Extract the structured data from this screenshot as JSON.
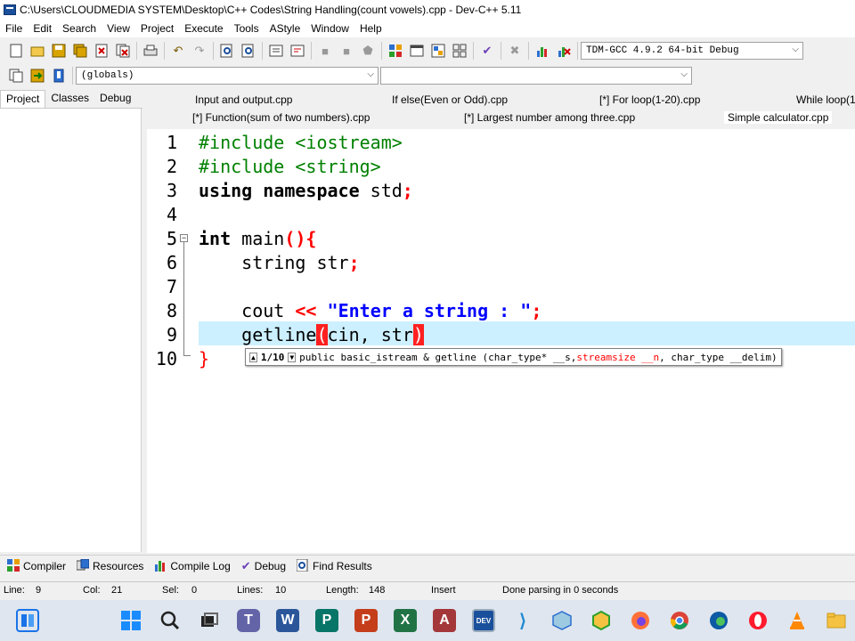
{
  "window": {
    "title": "C:\\Users\\CLOUDMEDIA SYSTEM\\Desktop\\C++ Codes\\String Handling(count vowels).cpp - Dev-C++ 5.11"
  },
  "menu": [
    "File",
    "Edit",
    "Search",
    "View",
    "Project",
    "Execute",
    "Tools",
    "AStyle",
    "Window",
    "Help"
  ],
  "toolbar": {
    "compiler_select": "TDM-GCC 4.9.2 64-bit Debug",
    "scope_select": "(globals)",
    "symbol_select": ""
  },
  "left_tabs": [
    "Project",
    "Classes",
    "Debug"
  ],
  "file_tabs_row1": [
    "Input and output.cpp",
    "If else(Even or Odd).cpp",
    "[*] For loop(1-20).cpp",
    "While loop(1"
  ],
  "file_tabs_row2": [
    "[*] Function(sum of two numbers).cpp",
    "[*] Largest number among three.cpp",
    "Simple calculator.cpp"
  ],
  "line_numbers": [
    "1",
    "2",
    "3",
    "4",
    "5",
    "6",
    "7",
    "8",
    "9",
    "10"
  ],
  "code": {
    "l1_pp": "#include <iostream>",
    "l2_pp": "#include <string>",
    "l3_kw": "using namespace",
    "l3_rest": " std",
    "l3_semi": ";",
    "l5_kw": "int",
    "l5_fn": " main",
    "l5_br": "(){",
    "l6_indent": "    ",
    "l6_id": "string str",
    "l6_semi": ";",
    "l8_id": "cout ",
    "l8_op": "<<",
    "l8_str": " \"Enter a string : \"",
    "l8_semi": ";",
    "l9_fn": "getline",
    "l9_open": "(",
    "l9_args": "cin, str",
    "l9_close": ")",
    "l10_br": "}"
  },
  "hint": {
    "counter": "1/10",
    "sig_a": "public basic_istream & getline (char_type* __s, ",
    "sig_b": "streamsize __n",
    "sig_c": ", char_type __delim)"
  },
  "bottom_tabs": [
    {
      "label": "Compiler",
      "icon": "grid-icon"
    },
    {
      "label": "Resources",
      "icon": "resources-icon"
    },
    {
      "label": "Compile Log",
      "icon": "chart-icon"
    },
    {
      "label": "Debug",
      "icon": "check-icon"
    },
    {
      "label": "Find Results",
      "icon": "find-icon"
    }
  ],
  "status": {
    "line_label": "Line:",
    "line_value": "9",
    "col_label": "Col:",
    "col_value": "21",
    "sel_label": "Sel:",
    "sel_value": "0",
    "lines_label": "Lines:",
    "lines_value": "10",
    "length_label": "Length:",
    "length_value": "148",
    "mode": "Insert",
    "message": "Done parsing in 0 seconds"
  },
  "taskbar_icons": [
    "widgets-icon",
    "start-icon",
    "search-icon",
    "task-view-icon",
    "teams-icon",
    "word-icon",
    "publisher-icon",
    "powerpoint-icon",
    "excel-icon",
    "access-icon",
    "devcpp-icon",
    "vscode-icon",
    "virtualbox-icon",
    "app-icon",
    "firefox-icon",
    "chrome-icon",
    "edge-icon",
    "opera-icon",
    "vlc-icon",
    "folder-icon"
  ]
}
